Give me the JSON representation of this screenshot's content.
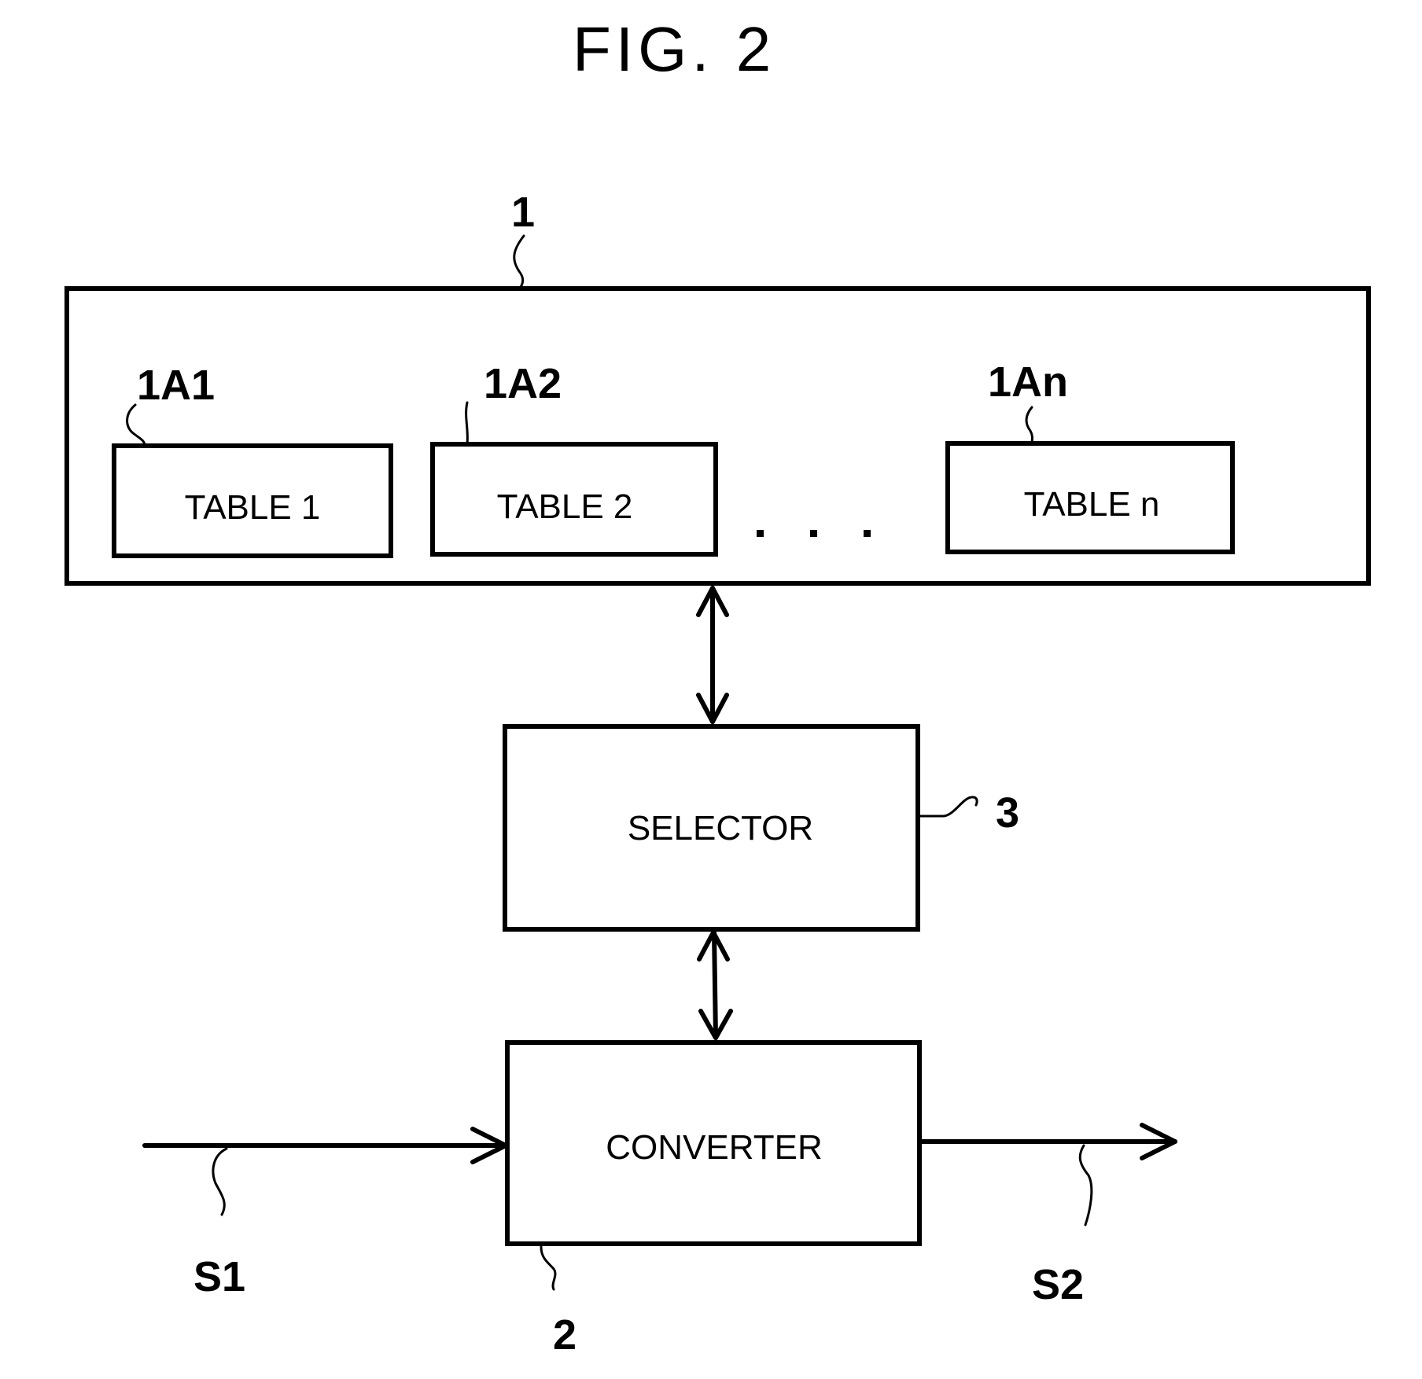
{
  "figure": {
    "title": "FIG. 2"
  },
  "table_store": {
    "ref": "1",
    "tables": [
      {
        "ref": "1A1",
        "label": "TABLE 1"
      },
      {
        "ref": "1A2",
        "label": "TABLE 2"
      },
      {
        "ref": "1An",
        "label": "TABLE n"
      }
    ],
    "ellipsis": "..."
  },
  "selector": {
    "label": "SELECTOR",
    "ref": "3"
  },
  "converter": {
    "label": "CONVERTER",
    "ref": "2"
  },
  "signals": {
    "input": "S1",
    "output": "S2"
  },
  "connections": [
    {
      "from": "1",
      "to": "3",
      "type": "bidirectional"
    },
    {
      "from": "3",
      "to": "2",
      "type": "bidirectional"
    },
    {
      "from": "S1",
      "to": "2",
      "type": "input"
    },
    {
      "from": "2",
      "to": "S2",
      "type": "output"
    }
  ]
}
